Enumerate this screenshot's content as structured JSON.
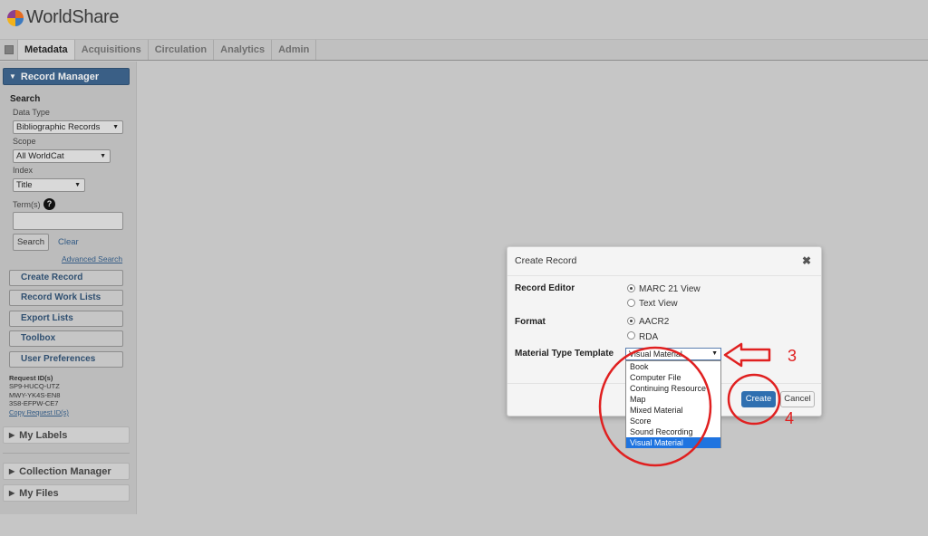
{
  "app": {
    "name": "WorldShare"
  },
  "nav": {
    "tabs": [
      "Metadata",
      "Acquisitions",
      "Circulation",
      "Analytics",
      "Admin"
    ],
    "active": "Metadata"
  },
  "sidebar": {
    "record_manager": "Record Manager",
    "search_heading": "Search",
    "data_type_label": "Data Type",
    "data_type_value": "Bibliographic Records",
    "scope_label": "Scope",
    "scope_value": "All WorldCat",
    "index_label": "Index",
    "index_value": "Title",
    "terms_label": "Term(s)",
    "search_button": "Search",
    "clear_link": "Clear",
    "advanced_link": "Advanced Search",
    "buttons": [
      "Create Record",
      "Record Work Lists",
      "Export Lists",
      "Toolbox",
      "User Preferences"
    ],
    "request_ids_label": "Request ID(s)",
    "request_ids": [
      "SP9-HUCQ-UTZ",
      "MWY-YK4S-EN8",
      "3S8-EFPW-CE7"
    ],
    "copy_link": "Copy Request ID(s)",
    "my_labels": "My Labels",
    "collection_manager": "Collection Manager",
    "my_files": "My Files"
  },
  "modal": {
    "title": "Create Record",
    "close": "✖",
    "record_editor_label": "Record Editor",
    "record_editor_options": [
      "MARC 21 View",
      "Text View"
    ],
    "format_label": "Format",
    "format_options": [
      "AACR2",
      "RDA"
    ],
    "material_type_label": "Material Type Template",
    "material_type_value": "Visual Material",
    "material_type_options": [
      "Book",
      "Computer File",
      "Continuing Resource",
      "Map",
      "Mixed Material",
      "Score",
      "Sound Recording",
      "Visual Material"
    ],
    "create_button": "Create",
    "cancel_button": "Cancel"
  },
  "annotations": {
    "step_3": "3",
    "step_4": "4",
    "color": "#e02020"
  }
}
